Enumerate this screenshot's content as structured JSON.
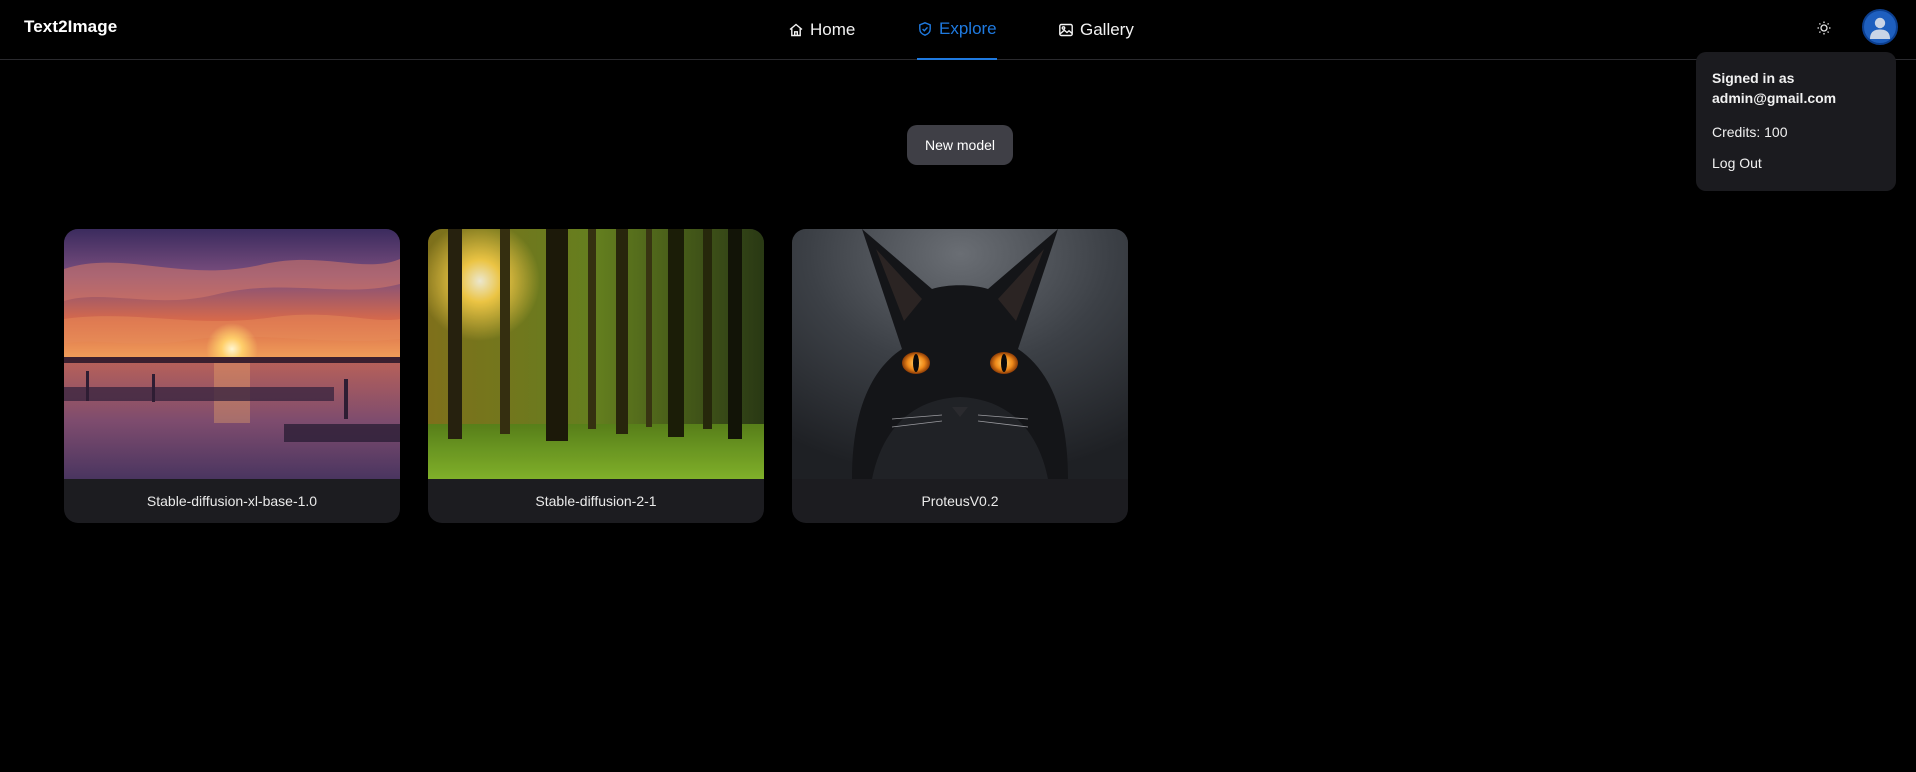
{
  "header": {
    "brand": "Text2Image",
    "nav": [
      {
        "label": "Home",
        "icon": "home-icon",
        "active": false
      },
      {
        "label": "Explore",
        "icon": "shield-icon",
        "active": true
      },
      {
        "label": "Gallery",
        "icon": "image-icon",
        "active": false
      }
    ],
    "theme_icon": "sun-icon",
    "avatar_icon": "user-avatar-icon"
  },
  "user_menu": {
    "signed_in_line1": "Signed in as",
    "signed_in_email": "admin@gmail.com",
    "credits": "Credits: 100",
    "logout": "Log Out"
  },
  "main": {
    "new_model_label": "New model",
    "models": [
      {
        "name": "Stable-diffusion-xl-base-1.0",
        "image": "sunset-lake"
      },
      {
        "name": "Stable-diffusion-2-1",
        "image": "sunlit-forest"
      },
      {
        "name": "ProteusV0.2",
        "image": "black-cat"
      }
    ]
  },
  "colors": {
    "accent": "#1f7ae0",
    "background": "#000000",
    "card": "#1c1c20",
    "button": "#3f3f46"
  }
}
